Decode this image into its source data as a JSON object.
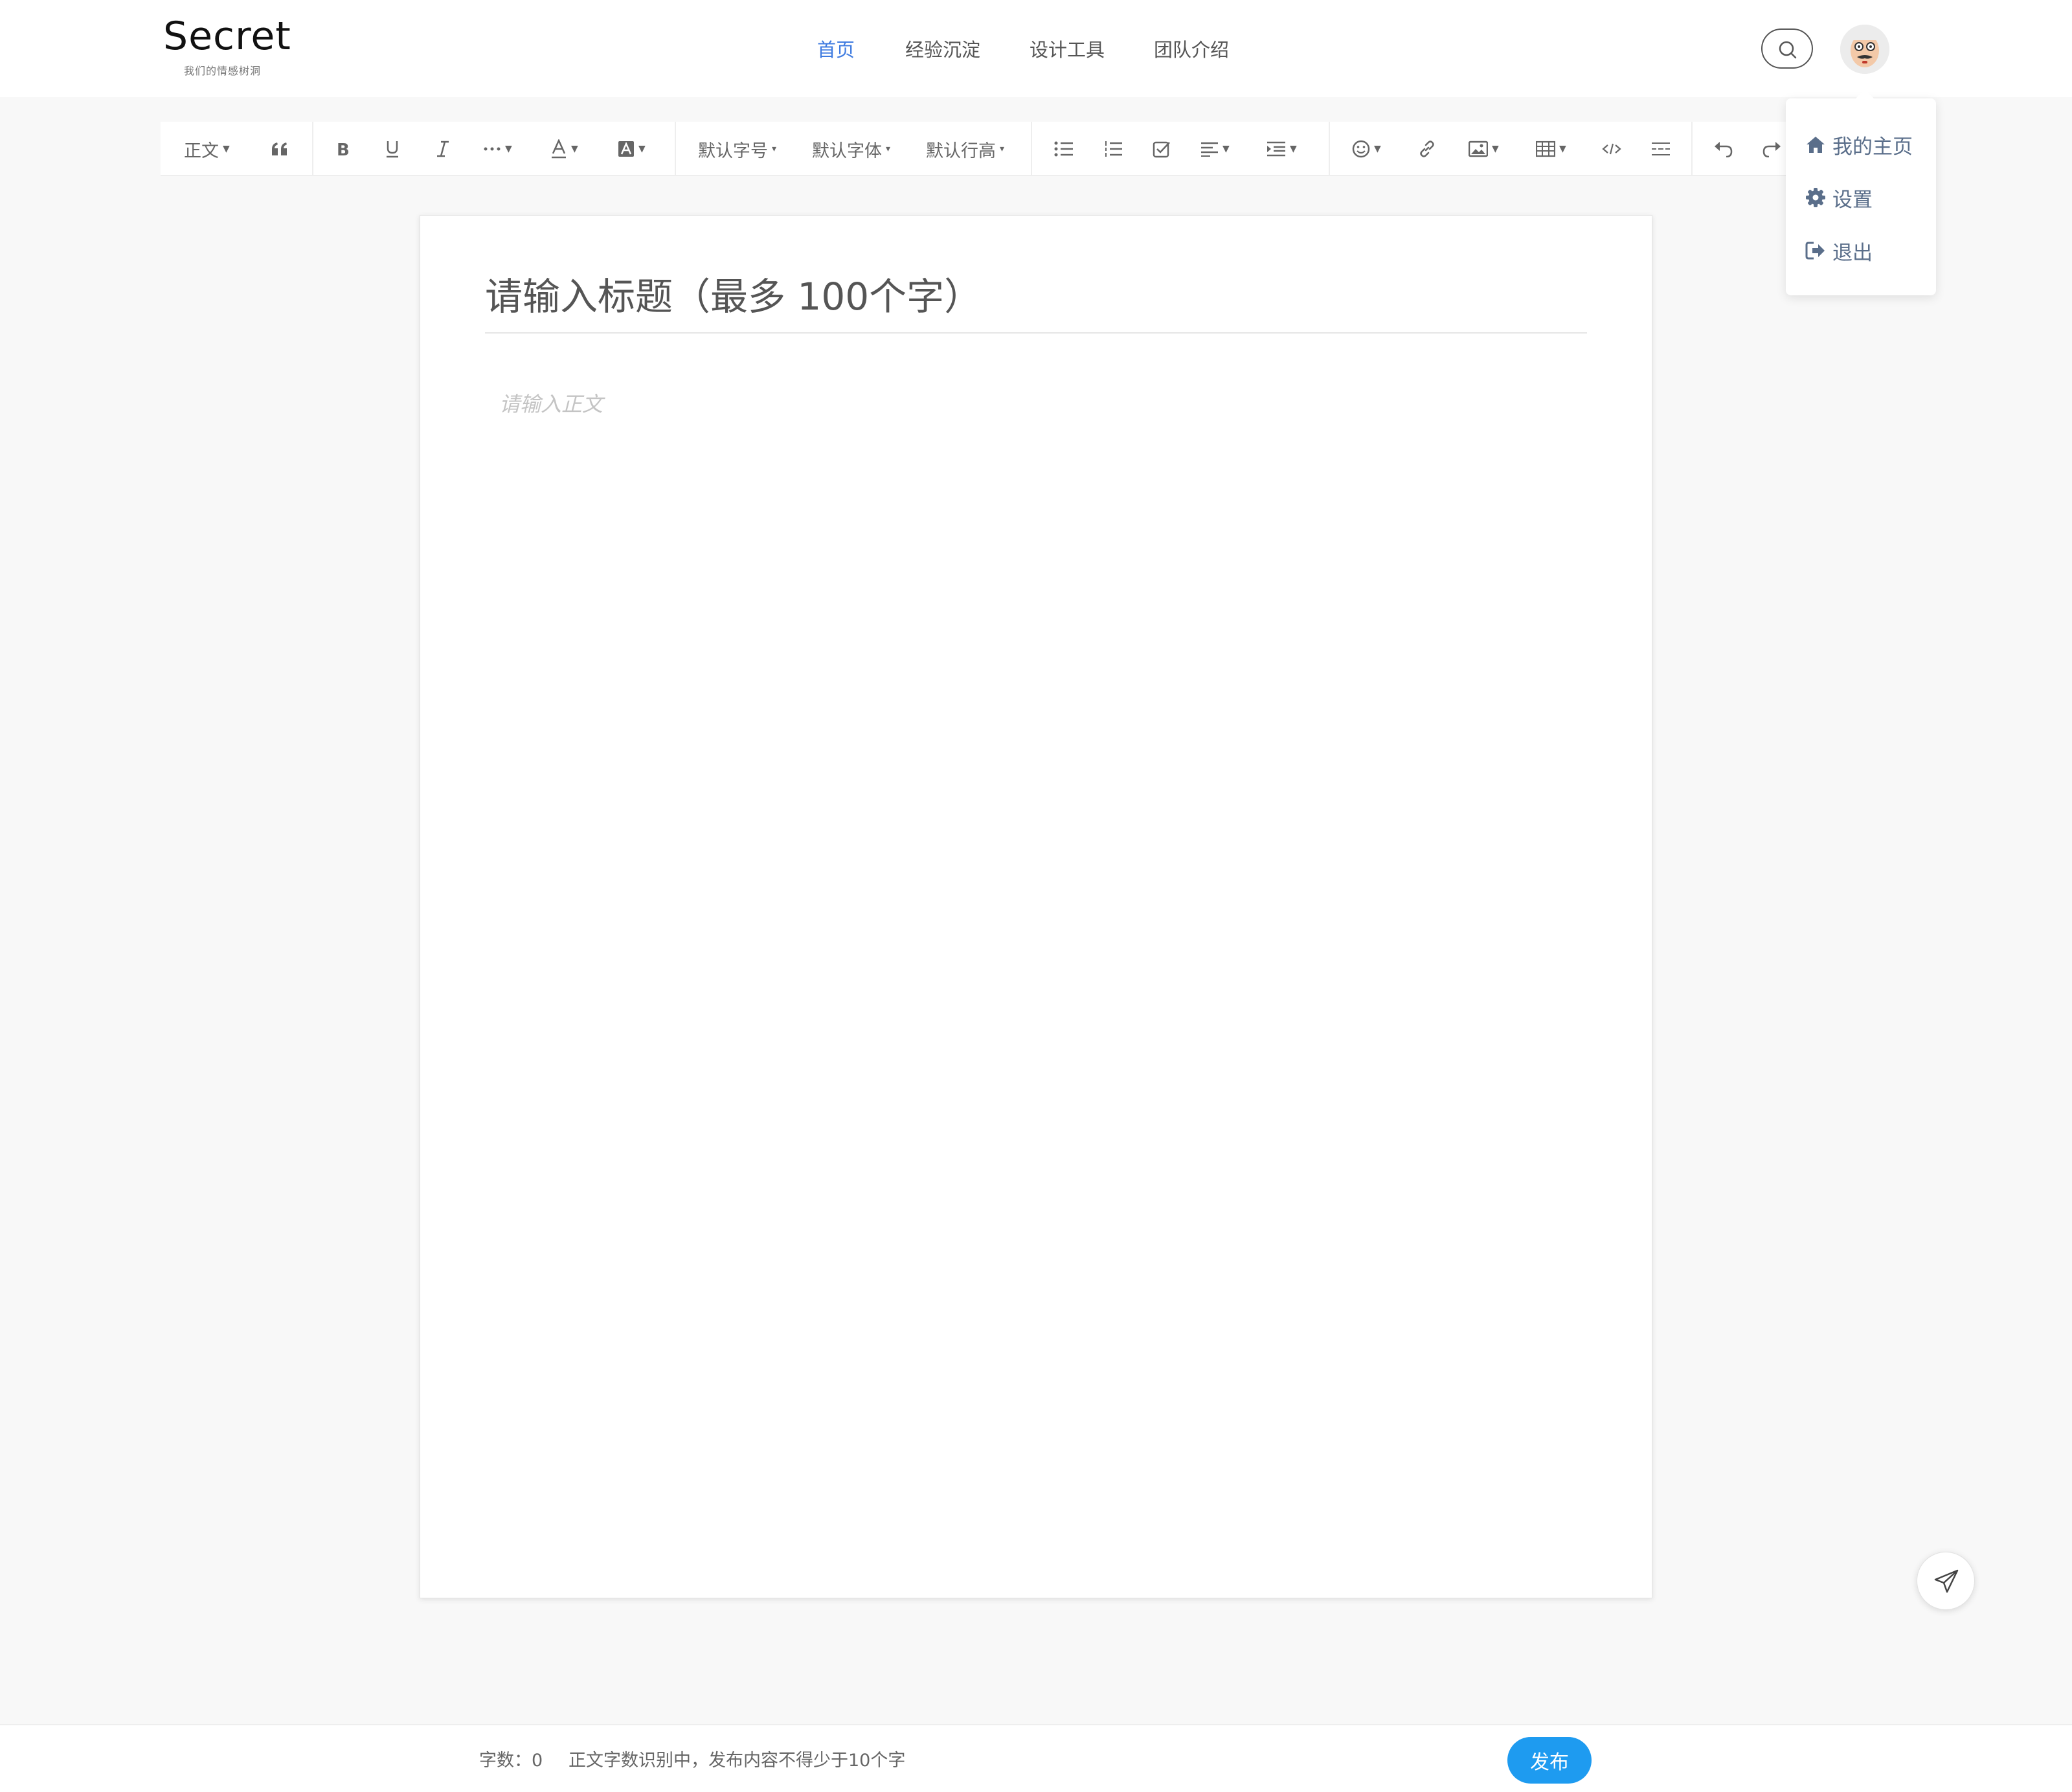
{
  "brand": {
    "title": "Secret",
    "subtitle": "我们的情感树洞"
  },
  "nav": {
    "items": [
      {
        "label": "首页",
        "active": true
      },
      {
        "label": "经验沉淀",
        "active": false
      },
      {
        "label": "设计工具",
        "active": false
      },
      {
        "label": "团队介绍",
        "active": false
      }
    ]
  },
  "toolbar": {
    "paragraph": "正文",
    "font_size": "默认字号",
    "font_family": "默认字体",
    "line_height": "默认行高"
  },
  "editor": {
    "title_placeholder": "请输入标题（最多 100个字）",
    "body_placeholder": "请输入正文"
  },
  "dropdown": {
    "items": [
      {
        "label": "我的主页",
        "icon": "home-icon"
      },
      {
        "label": "设置",
        "icon": "gear-icon"
      },
      {
        "label": "退出",
        "icon": "sign-out-icon"
      }
    ]
  },
  "footer": {
    "word_count_label": "字数：",
    "word_count": "0",
    "note": "正文字数识别中，发布内容不得少于10个字",
    "publish_label": "发布"
  },
  "colors": {
    "accent": "#3f7be0",
    "publish": "#1e9bf0",
    "menu_text": "#5a6e8a",
    "background": "#f8f8f8"
  }
}
